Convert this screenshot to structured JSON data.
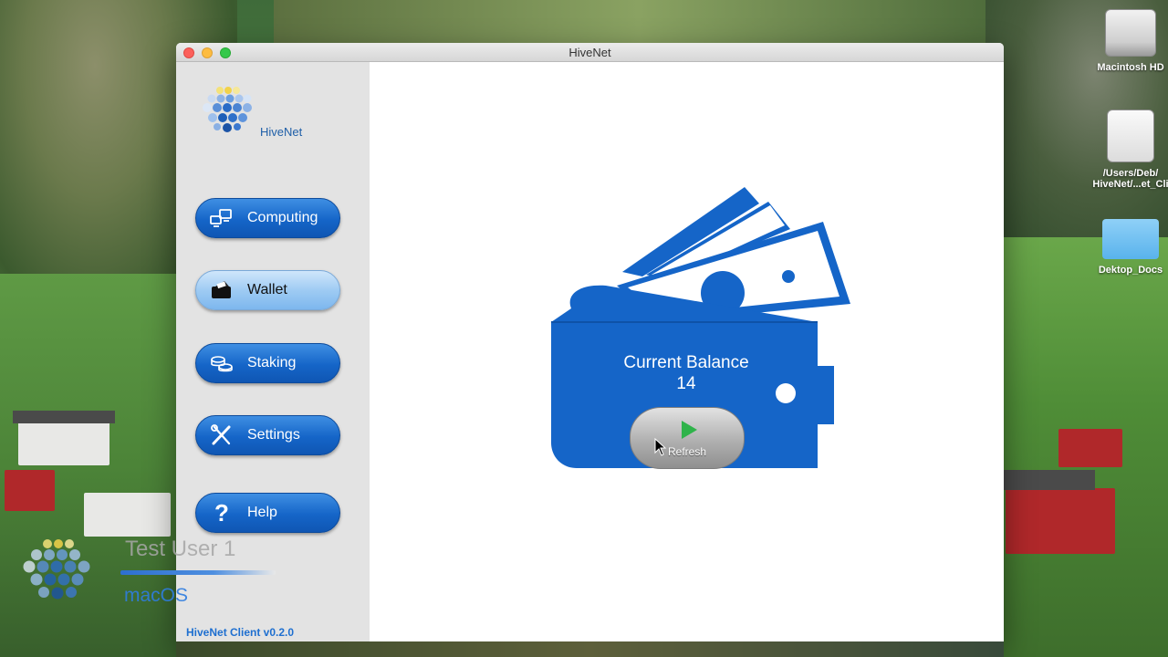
{
  "window": {
    "title": "HiveNet"
  },
  "sidebar": {
    "logo_text": "HiveNet",
    "items": [
      {
        "label": "Computing",
        "icon": "computing-icon",
        "active": false
      },
      {
        "label": "Wallet",
        "icon": "wallet-icon",
        "active": true
      },
      {
        "label": "Staking",
        "icon": "coins-icon",
        "active": false
      },
      {
        "label": "Settings",
        "icon": "tools-icon",
        "active": false
      },
      {
        "label": "Help",
        "icon": "question-icon",
        "active": false
      }
    ],
    "version": "HiveNet Client v0.2.0"
  },
  "wallet": {
    "title": "Current Balance",
    "balance": "14",
    "refresh_label": "Refresh"
  },
  "desktop": {
    "icons": [
      {
        "label": "Macintosh HD",
        "icon": "hard-drive-icon"
      },
      {
        "label": "/Users/Deb/ HiveNet/...et_Cli",
        "icon": "disk-image-icon"
      },
      {
        "label": "Dektop_Docs",
        "icon": "folder-icon"
      }
    ]
  },
  "overlay": {
    "user_name": "Test User 1",
    "os_name": "macOS"
  },
  "colors": {
    "accent_blue": "#1565c8",
    "wallet_blue": "#1565c8",
    "sidebar_bg": "#e3e3e3",
    "play_green": "#2fb34a"
  }
}
